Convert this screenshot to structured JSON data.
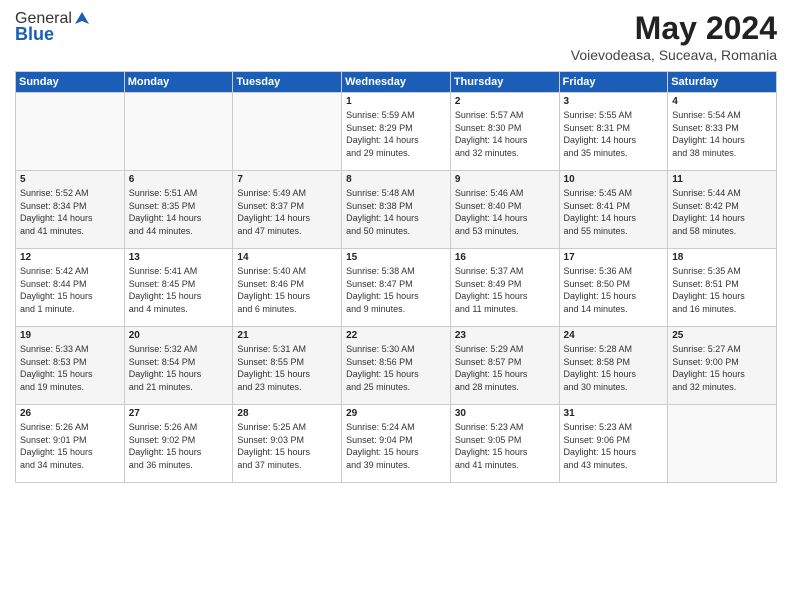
{
  "logo": {
    "general": "General",
    "blue": "Blue"
  },
  "title": "May 2024",
  "location": "Voievodeasa, Suceava, Romania",
  "days_header": [
    "Sunday",
    "Monday",
    "Tuesday",
    "Wednesday",
    "Thursday",
    "Friday",
    "Saturday"
  ],
  "weeks": [
    [
      {
        "day": "",
        "info": ""
      },
      {
        "day": "",
        "info": ""
      },
      {
        "day": "",
        "info": ""
      },
      {
        "day": "1",
        "info": "Sunrise: 5:59 AM\nSunset: 8:29 PM\nDaylight: 14 hours\nand 29 minutes."
      },
      {
        "day": "2",
        "info": "Sunrise: 5:57 AM\nSunset: 8:30 PM\nDaylight: 14 hours\nand 32 minutes."
      },
      {
        "day": "3",
        "info": "Sunrise: 5:55 AM\nSunset: 8:31 PM\nDaylight: 14 hours\nand 35 minutes."
      },
      {
        "day": "4",
        "info": "Sunrise: 5:54 AM\nSunset: 8:33 PM\nDaylight: 14 hours\nand 38 minutes."
      }
    ],
    [
      {
        "day": "5",
        "info": "Sunrise: 5:52 AM\nSunset: 8:34 PM\nDaylight: 14 hours\nand 41 minutes."
      },
      {
        "day": "6",
        "info": "Sunrise: 5:51 AM\nSunset: 8:35 PM\nDaylight: 14 hours\nand 44 minutes."
      },
      {
        "day": "7",
        "info": "Sunrise: 5:49 AM\nSunset: 8:37 PM\nDaylight: 14 hours\nand 47 minutes."
      },
      {
        "day": "8",
        "info": "Sunrise: 5:48 AM\nSunset: 8:38 PM\nDaylight: 14 hours\nand 50 minutes."
      },
      {
        "day": "9",
        "info": "Sunrise: 5:46 AM\nSunset: 8:40 PM\nDaylight: 14 hours\nand 53 minutes."
      },
      {
        "day": "10",
        "info": "Sunrise: 5:45 AM\nSunset: 8:41 PM\nDaylight: 14 hours\nand 55 minutes."
      },
      {
        "day": "11",
        "info": "Sunrise: 5:44 AM\nSunset: 8:42 PM\nDaylight: 14 hours\nand 58 minutes."
      }
    ],
    [
      {
        "day": "12",
        "info": "Sunrise: 5:42 AM\nSunset: 8:44 PM\nDaylight: 15 hours\nand 1 minute."
      },
      {
        "day": "13",
        "info": "Sunrise: 5:41 AM\nSunset: 8:45 PM\nDaylight: 15 hours\nand 4 minutes."
      },
      {
        "day": "14",
        "info": "Sunrise: 5:40 AM\nSunset: 8:46 PM\nDaylight: 15 hours\nand 6 minutes."
      },
      {
        "day": "15",
        "info": "Sunrise: 5:38 AM\nSunset: 8:47 PM\nDaylight: 15 hours\nand 9 minutes."
      },
      {
        "day": "16",
        "info": "Sunrise: 5:37 AM\nSunset: 8:49 PM\nDaylight: 15 hours\nand 11 minutes."
      },
      {
        "day": "17",
        "info": "Sunrise: 5:36 AM\nSunset: 8:50 PM\nDaylight: 15 hours\nand 14 minutes."
      },
      {
        "day": "18",
        "info": "Sunrise: 5:35 AM\nSunset: 8:51 PM\nDaylight: 15 hours\nand 16 minutes."
      }
    ],
    [
      {
        "day": "19",
        "info": "Sunrise: 5:33 AM\nSunset: 8:53 PM\nDaylight: 15 hours\nand 19 minutes."
      },
      {
        "day": "20",
        "info": "Sunrise: 5:32 AM\nSunset: 8:54 PM\nDaylight: 15 hours\nand 21 minutes."
      },
      {
        "day": "21",
        "info": "Sunrise: 5:31 AM\nSunset: 8:55 PM\nDaylight: 15 hours\nand 23 minutes."
      },
      {
        "day": "22",
        "info": "Sunrise: 5:30 AM\nSunset: 8:56 PM\nDaylight: 15 hours\nand 25 minutes."
      },
      {
        "day": "23",
        "info": "Sunrise: 5:29 AM\nSunset: 8:57 PM\nDaylight: 15 hours\nand 28 minutes."
      },
      {
        "day": "24",
        "info": "Sunrise: 5:28 AM\nSunset: 8:58 PM\nDaylight: 15 hours\nand 30 minutes."
      },
      {
        "day": "25",
        "info": "Sunrise: 5:27 AM\nSunset: 9:00 PM\nDaylight: 15 hours\nand 32 minutes."
      }
    ],
    [
      {
        "day": "26",
        "info": "Sunrise: 5:26 AM\nSunset: 9:01 PM\nDaylight: 15 hours\nand 34 minutes."
      },
      {
        "day": "27",
        "info": "Sunrise: 5:26 AM\nSunset: 9:02 PM\nDaylight: 15 hours\nand 36 minutes."
      },
      {
        "day": "28",
        "info": "Sunrise: 5:25 AM\nSunset: 9:03 PM\nDaylight: 15 hours\nand 37 minutes."
      },
      {
        "day": "29",
        "info": "Sunrise: 5:24 AM\nSunset: 9:04 PM\nDaylight: 15 hours\nand 39 minutes."
      },
      {
        "day": "30",
        "info": "Sunrise: 5:23 AM\nSunset: 9:05 PM\nDaylight: 15 hours\nand 41 minutes."
      },
      {
        "day": "31",
        "info": "Sunrise: 5:23 AM\nSunset: 9:06 PM\nDaylight: 15 hours\nand 43 minutes."
      },
      {
        "day": "",
        "info": ""
      }
    ]
  ]
}
